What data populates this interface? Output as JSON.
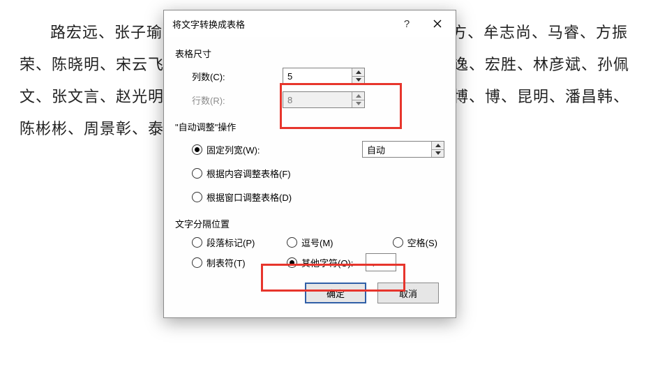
{
  "document_text": "路宏远、张子瑜、蓝若灵、林天佑、周子墨、王志专、刘方、牟志尚、马睿、方振荣、陈晓明、宋云飞、周开霁、开雰、董明珠、许长逸、郭天逸、宏胜、林彦斌、孙佩文、张文言、赵光明、李智刚、张巍奕、申强、刘文博、徐伟博、博、昆明、潘昌韩、陈彬彬、周景彰、泰宁",
  "dialog": {
    "title": "将文字转换成表格",
    "size_section": "表格尺寸",
    "cols_label": "列数(C):",
    "cols_value": "5",
    "rows_label": "行数(R):",
    "rows_value": "8",
    "autofit_section": "\"自动调整\"操作",
    "fixed_width_label": "固定列宽(W):",
    "fixed_width_value": "自动",
    "fit_content_label": "根据内容调整表格(F)",
    "fit_window_label": "根据窗口调整表格(D)",
    "sep_section": "文字分隔位置",
    "sep_para": "段落标记(P)",
    "sep_comma": "逗号(M)",
    "sep_space": "空格(S)",
    "sep_tab": "制表符(T)",
    "sep_other": "其他字符(O):",
    "sep_char": "、",
    "ok": "确定",
    "cancel": "取消"
  },
  "chart_data": {
    "type": "table",
    "note": "dialog to convert text to table",
    "columns_count": 5,
    "rows_count": 8,
    "autofit_mode": "fixed",
    "fixed_width": "自动",
    "separator": "other",
    "separator_char": "、"
  }
}
